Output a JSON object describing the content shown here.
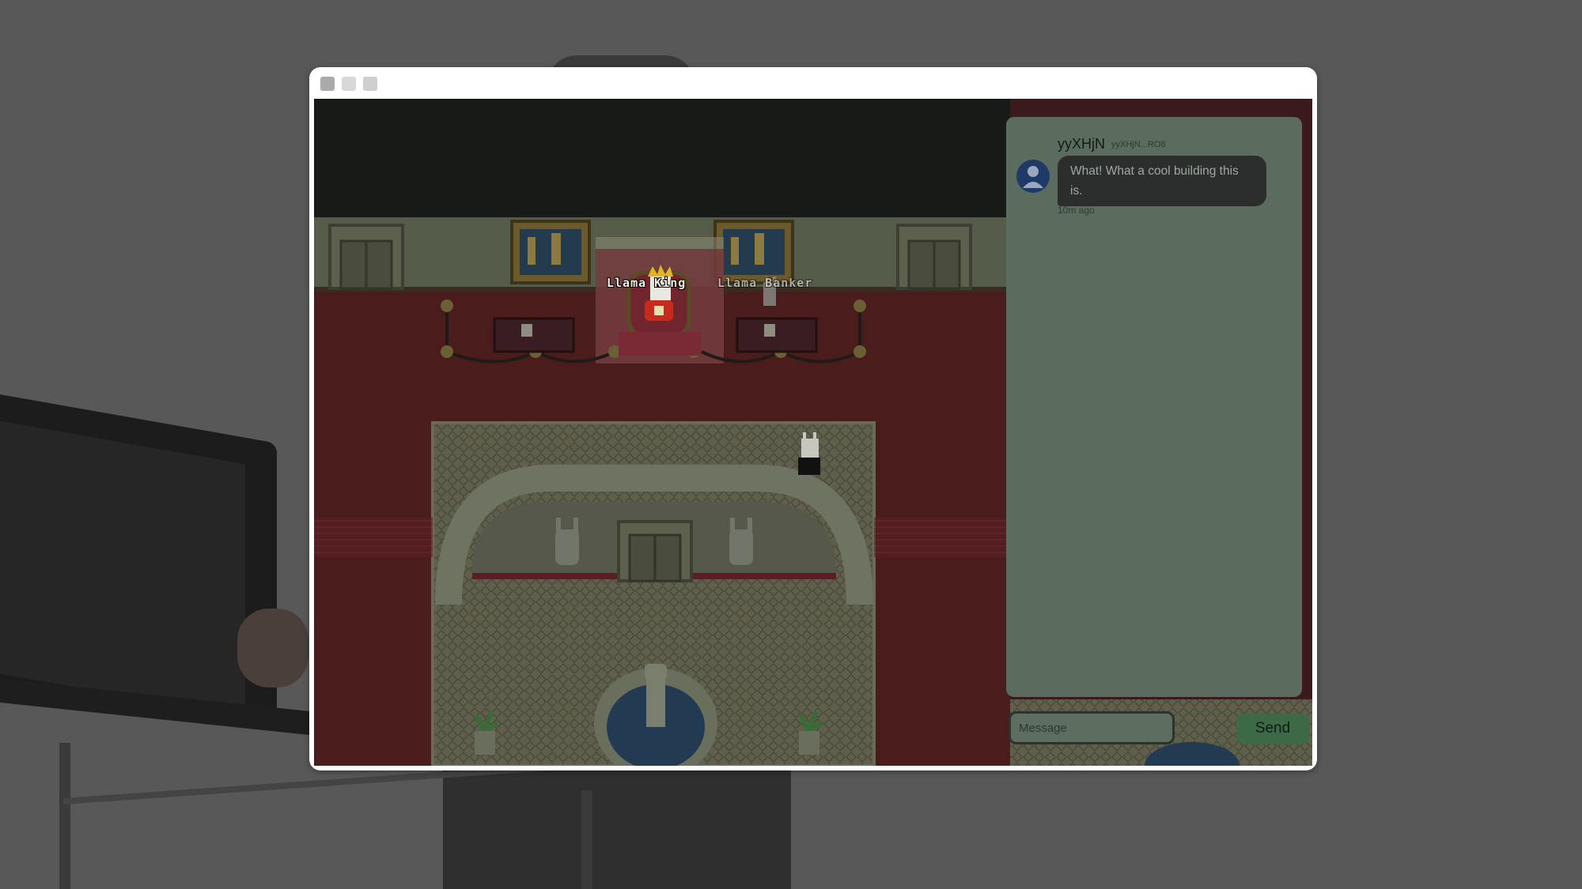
{
  "game": {
    "npcs": [
      {
        "name": "Llama King"
      },
      {
        "name": "Llama Banker"
      }
    ]
  },
  "chat": {
    "messages": [
      {
        "username": "yyXHjN",
        "user_id": "yyXHjN...RO8",
        "text": "What! What a cool building this is.",
        "time": "10m ago"
      }
    ],
    "input_placeholder": "Message",
    "send_label": "Send"
  },
  "icons": {
    "avatar": "user-avatar-icon"
  },
  "colors": {
    "send_button": "#3c6a47",
    "chat_panel": "#5b6c5e",
    "floor_carpet": "#4b1c1c",
    "wall": "#545b49"
  }
}
